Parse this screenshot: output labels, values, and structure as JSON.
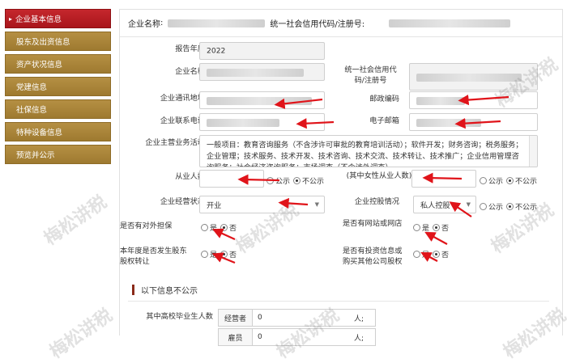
{
  "sidebar": {
    "items": [
      {
        "label": "企业基本信息",
        "active": true
      },
      {
        "label": "股东及出资信息"
      },
      {
        "label": "资产状况信息"
      },
      {
        "label": "党建信息"
      },
      {
        "label": "社保信息"
      },
      {
        "label": "特种设备信息"
      },
      {
        "label": "预览并公示"
      }
    ]
  },
  "header": {
    "company_name_label": "企业名称",
    "credit_code_label": "统一社会信用代码/注册号:"
  },
  "form": {
    "report_year_label": "报告年度",
    "report_year_value": "2022",
    "company_name_label": "企业名称",
    "credit_code_label": "统一社会信用代码/注册号",
    "address_label": "企业通讯地址",
    "postcode_label": "邮政编码",
    "phone_label": "企业联系电话",
    "email_label": "电子邮箱",
    "business_label": "企业主营业务活动",
    "business_value": "一般项目：教育咨询服务（不含涉许可审批的教育培训活动）；软件开发；财务咨询；税务服务；企业管理；技术服务、技术开发、技术咨询、技术交流、技术转让、技术推广；企业信用管理咨询服务；社会经济咨询服务；市场调查（不含涉外调查）",
    "employees_label": "从业人数",
    "female_employees_label": "(其中女性从业人数)",
    "public_label": "公示",
    "not_public_label": "不公示",
    "status_label": "企业经营状态",
    "status_value": "开业",
    "control_label": "企业控股情况",
    "control_value": "私人控股",
    "guarantee_label": "是否有对外担保",
    "website_label": "是否有网站或网店",
    "equity_transfer_label": "本年度是否发生股东股权转让",
    "investment_label": "是否有投资信息或购买其他公司股权",
    "yes_label": "是",
    "no_label": "否"
  },
  "section": {
    "title": "以下信息不公示",
    "grads_label": "其中高校毕业生人数",
    "operator_label": "经营者",
    "operator_value": "0",
    "employee_label": "雇员",
    "employee_value": "0",
    "unit": "人;"
  },
  "watermark": "梅松讲税",
  "colors": {
    "active_tab": "#b81e24",
    "tab": "#a98536",
    "annotation_arrow": "#e0141a",
    "section_bar": "#8b2b1a"
  }
}
